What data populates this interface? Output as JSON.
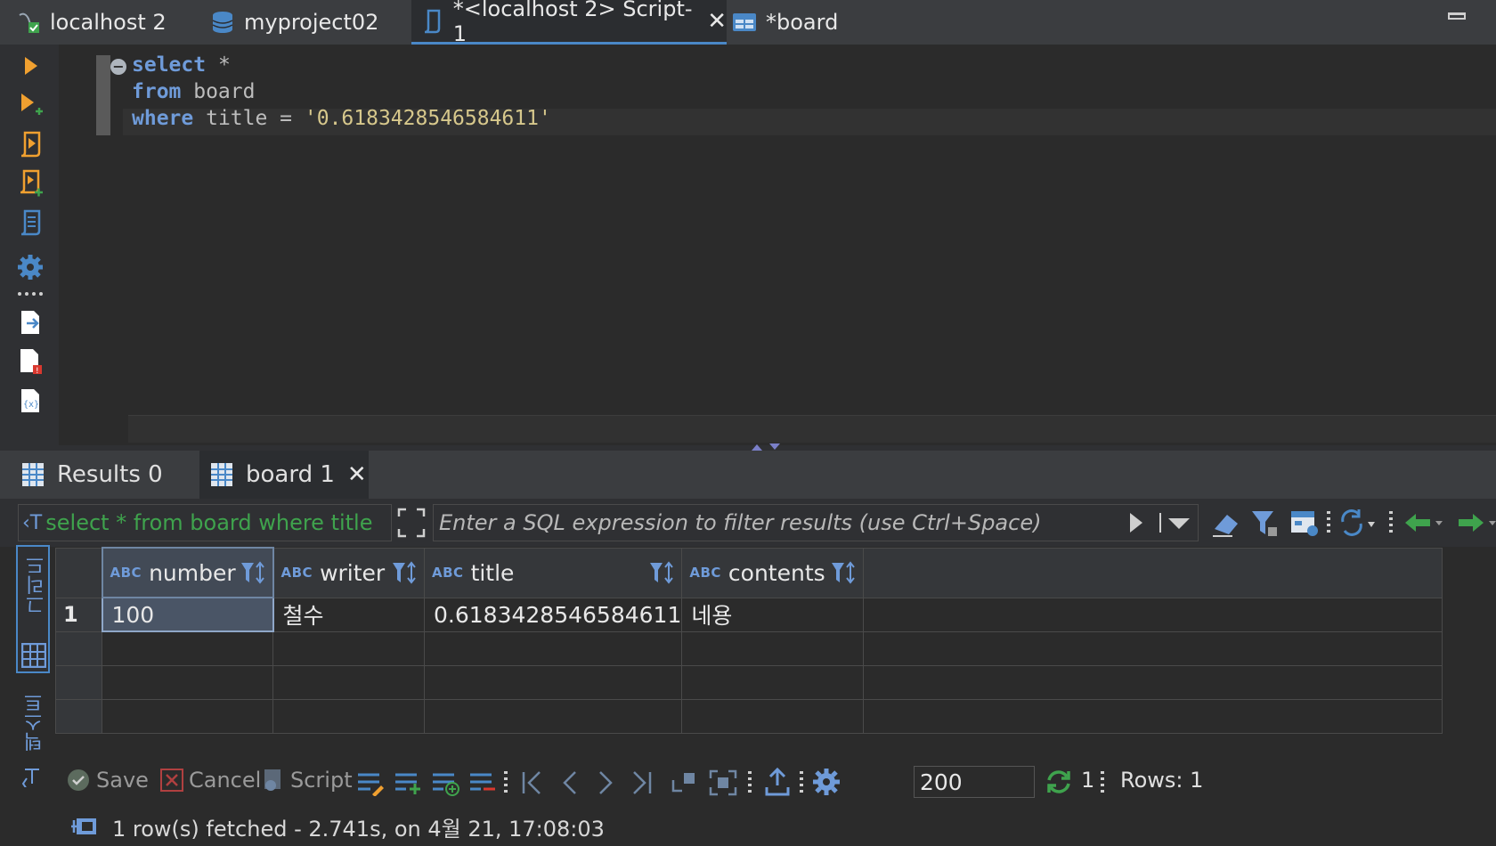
{
  "editor_tabs": [
    {
      "label": "localhost 2",
      "icon": "connection-icon"
    },
    {
      "label": "myproject02",
      "icon": "database-icon"
    },
    {
      "label": "*<localhost 2> Script-1",
      "icon": "sql-script-icon",
      "active": true
    },
    {
      "label": "*board",
      "icon": "table-icon"
    }
  ],
  "editor": {
    "lines": [
      {
        "keyword": "select",
        "rest": " *"
      },
      {
        "keyword": "from",
        "rest": " board"
      },
      {
        "keyword": "where",
        "rest": " title = ",
        "string": "'0.6183428546584611'"
      }
    ]
  },
  "left_toolbar": [
    "execute-statement-icon",
    "execute-in-new-tab-icon",
    "execute-script-icon",
    "execute-script-new-tab-icon",
    "explain-plan-icon",
    "settings-gear-icon",
    "more-dots-icon",
    "export-icon",
    "load-file-icon",
    "variables-icon"
  ],
  "result_tabs": [
    {
      "label": "Results 0"
    },
    {
      "label": "board 1",
      "active": true
    }
  ],
  "filter": {
    "query_text": "select * from board where title",
    "placeholder": "Enter a SQL expression to filter results (use Ctrl+Space)"
  },
  "side_tabs": [
    "그리드",
    "텍스트"
  ],
  "grid": {
    "columns": [
      {
        "name": "number",
        "type": "ABC"
      },
      {
        "name": "writer",
        "type": "ABC"
      },
      {
        "name": "title",
        "type": "ABC"
      },
      {
        "name": "contents",
        "type": "ABC"
      }
    ],
    "rows": [
      {
        "num": "1",
        "cells": [
          "100",
          "철수",
          "0.6183428546584611",
          "네용"
        ]
      }
    ]
  },
  "bottom_toolbar": {
    "save": "Save",
    "cancel": "Cancel",
    "script": "Script",
    "fetch_size": "200",
    "refresh_count": "1",
    "rows_label": "Rows: 1"
  },
  "status": "1 row(s) fetched - 2.741s, on 4월 21, 17:08:03",
  "colors": {
    "accent": "#4a88c7",
    "keyword": "#6f9bd9",
    "string": "#d7c88c",
    "green": "#3fa34d"
  }
}
